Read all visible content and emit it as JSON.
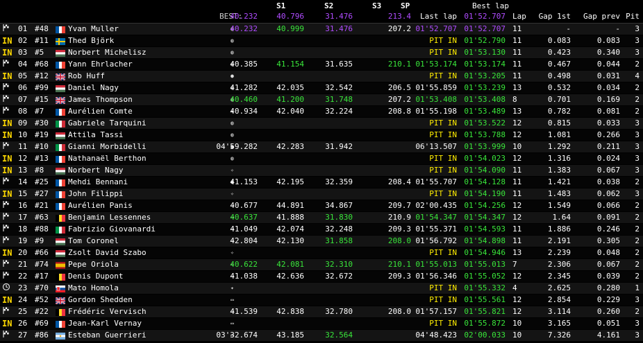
{
  "header": {
    "best_label": "BEST:",
    "s1": "S1",
    "s2": "S2",
    "s3": "S3",
    "sp": "SP",
    "last_lap": "Last lap",
    "best_lap_top": "Best lap",
    "lap": "Lap",
    "gap1": "Gap 1st",
    "gapprev": "Gap prev",
    "pit": "Pit",
    "best_s1": "40.232",
    "best_s2": "40.796",
    "best_s3": "31.476",
    "best_sp": "213.4",
    "best_lap": "01'52.707"
  },
  "colors": {
    "purple": "#b04cff",
    "green": "#39e63a",
    "yellow": "#ffee00"
  },
  "rows": [
    {
      "status": "flag",
      "pos": "01",
      "num": "#48",
      "flag": "FR",
      "name": "Yvan Muller",
      "s1": "40.232",
      "s1c": "purple",
      "s2": "40.999",
      "s2c": "green",
      "s3": "31.476",
      "s3c": "purple",
      "sp": "207.2",
      "spc": "white",
      "last": "01'52.707",
      "lastc": "purple",
      "best": "01'52.707",
      "bestc": "purple",
      "lap": "11",
      "gap1": "-",
      "gapp": "-",
      "pit": "3"
    },
    {
      "status": "in",
      "pos": "02",
      "num": "#11",
      "flag": "SE",
      "name": "Thed Björk",
      "s1": "",
      "s2": "",
      "s3": "",
      "sp": "",
      "last": "PIT IN",
      "lastc": "yellow",
      "best": "01'52.790",
      "bestc": "green",
      "lap": "11",
      "gap1": "0.083",
      "gapp": "0.083",
      "pit": "3"
    },
    {
      "status": "in",
      "pos": "03",
      "num": "#5",
      "flag": "HU",
      "name": "Norbert Michelisz",
      "s1": "",
      "s2": "",
      "s3": "",
      "sp": "",
      "last": "PIT IN",
      "lastc": "yellow",
      "best": "01'53.130",
      "bestc": "green",
      "lap": "11",
      "gap1": "0.423",
      "gapp": "0.340",
      "pit": "3"
    },
    {
      "status": "flag",
      "pos": "04",
      "num": "#68",
      "flag": "FR",
      "name": "Yann Ehrlacher",
      "s1": "40.385",
      "s1c": "white",
      "s2": "41.154",
      "s2c": "green",
      "s3": "31.635",
      "s3c": "white",
      "sp": "210.1",
      "spc": "green",
      "last": "01'53.174",
      "lastc": "green",
      "best": "01'53.174",
      "bestc": "green",
      "lap": "11",
      "gap1": "0.467",
      "gapp": "0.044",
      "pit": "2"
    },
    {
      "status": "in",
      "pos": "05",
      "num": "#12",
      "flag": "GB",
      "name": "Rob Huff",
      "s1": "",
      "s2": "",
      "s3": "",
      "sp": "",
      "last": "PIT IN",
      "lastc": "yellow",
      "best": "01'53.205",
      "bestc": "green",
      "lap": "11",
      "gap1": "0.498",
      "gapp": "0.031",
      "pit": "4"
    },
    {
      "status": "flag",
      "pos": "06",
      "num": "#99",
      "flag": "HU",
      "name": "Daniel Nagy",
      "s1": "41.282",
      "s1c": "white",
      "s2": "42.035",
      "s2c": "white",
      "s3": "32.542",
      "s3c": "white",
      "sp": "206.5",
      "spc": "white",
      "last": "01'55.859",
      "lastc": "white",
      "best": "01'53.239",
      "bestc": "green",
      "lap": "13",
      "gap1": "0.532",
      "gapp": "0.034",
      "pit": "2"
    },
    {
      "status": "flag",
      "pos": "07",
      "num": "#15",
      "flag": "GB",
      "name": "James Thompson",
      "s1": "40.460",
      "s1c": "green",
      "s2": "41.200",
      "s2c": "green",
      "s3": "31.748",
      "s3c": "green",
      "sp": "207.2",
      "spc": "white",
      "last": "01'53.408",
      "lastc": "green",
      "best": "01'53.408",
      "bestc": "green",
      "lap": "8",
      "gap1": "0.701",
      "gapp": "0.169",
      "pit": "2"
    },
    {
      "status": "flag",
      "pos": "08",
      "num": "#7",
      "flag": "FR",
      "name": "Aurélien Comte",
      "s1": "40.934",
      "s1c": "white",
      "s2": "42.040",
      "s2c": "white",
      "s3": "32.224",
      "s3c": "white",
      "sp": "208.8",
      "spc": "white",
      "last": "01'55.198",
      "lastc": "white",
      "best": "01'53.489",
      "bestc": "green",
      "lap": "13",
      "gap1": "0.782",
      "gapp": "0.081",
      "pit": "2"
    },
    {
      "status": "in",
      "pos": "09",
      "num": "#30",
      "flag": "IT",
      "name": "Gabriele Tarquini",
      "s1": "",
      "s2": "",
      "s3": "",
      "sp": "",
      "last": "PIT IN",
      "lastc": "yellow",
      "best": "01'53.522",
      "bestc": "green",
      "lap": "12",
      "gap1": "0.815",
      "gapp": "0.033",
      "pit": "3"
    },
    {
      "status": "in",
      "pos": "10",
      "num": "#19",
      "flag": "HU",
      "name": "Attila Tassi",
      "s1": "",
      "s2": "",
      "s3": "",
      "sp": "",
      "last": "PIT IN",
      "lastc": "yellow",
      "best": "01'53.788",
      "bestc": "green",
      "lap": "12",
      "gap1": "1.081",
      "gapp": "0.266",
      "pit": "3"
    },
    {
      "status": "flag",
      "pos": "11",
      "num": "#10",
      "flag": "IT",
      "name": "Gianni Morbidelli",
      "s1": "04'59.282",
      "s1c": "white",
      "s2": "42.283",
      "s2c": "white",
      "s3": "31.942",
      "s3c": "white",
      "sp": "",
      "spc": "white",
      "last": "06'13.507",
      "lastc": "white",
      "best": "01'53.999",
      "bestc": "green",
      "lap": "10",
      "gap1": "1.292",
      "gapp": "0.211",
      "pit": "3"
    },
    {
      "status": "in",
      "pos": "12",
      "num": "#13",
      "flag": "FR",
      "name": "Nathanaël Berthon",
      "s1": "",
      "s2": "",
      "s3": "",
      "sp": "",
      "last": "PIT IN",
      "lastc": "yellow",
      "best": "01'54.023",
      "bestc": "green",
      "lap": "12",
      "gap1": "1.316",
      "gapp": "0.024",
      "pit": "3"
    },
    {
      "status": "in",
      "pos": "13",
      "num": "#8",
      "flag": "HU",
      "name": "Norbert Nagy",
      "s1": "",
      "s2": "",
      "s3": "",
      "sp": "",
      "last": "PIT IN",
      "lastc": "yellow",
      "best": "01'54.090",
      "bestc": "green",
      "lap": "11",
      "gap1": "1.383",
      "gapp": "0.067",
      "pit": "3"
    },
    {
      "status": "flag",
      "pos": "14",
      "num": "#25",
      "flag": "FR",
      "name": "Mehdi Bennani",
      "s1": "41.153",
      "s1c": "white",
      "s2": "42.195",
      "s2c": "white",
      "s3": "32.359",
      "s3c": "white",
      "sp": "208.4",
      "spc": "white",
      "last": "01'55.707",
      "lastc": "white",
      "best": "01'54.128",
      "bestc": "green",
      "lap": "11",
      "gap1": "1.421",
      "gapp": "0.038",
      "pit": "2"
    },
    {
      "status": "in",
      "pos": "15",
      "num": "#27",
      "flag": "FR",
      "name": "John Filippi",
      "s1": "",
      "s2": "",
      "s3": "",
      "sp": "",
      "last": "PIT IN",
      "lastc": "yellow",
      "best": "01'54.190",
      "bestc": "green",
      "lap": "11",
      "gap1": "1.483",
      "gapp": "0.062",
      "pit": "3"
    },
    {
      "status": "flag",
      "pos": "16",
      "num": "#21",
      "flag": "FR",
      "name": "Aurélien Panis",
      "s1": "40.677",
      "s1c": "white",
      "s2": "44.891",
      "s2c": "white",
      "s3": "34.867",
      "s3c": "white",
      "sp": "209.7",
      "spc": "white",
      "last": "02'00.435",
      "lastc": "white",
      "best": "01'54.256",
      "bestc": "green",
      "lap": "12",
      "gap1": "1.549",
      "gapp": "0.066",
      "pit": "2"
    },
    {
      "status": "flag",
      "pos": "17",
      "num": "#63",
      "flag": "BE",
      "name": "Benjamin Lessennes",
      "s1": "40.637",
      "s1c": "green",
      "s2": "41.888",
      "s2c": "white",
      "s3": "31.830",
      "s3c": "green",
      "sp": "210.9",
      "spc": "white",
      "last": "01'54.347",
      "lastc": "green",
      "best": "01'54.347",
      "bestc": "green",
      "lap": "12",
      "gap1": "1.64",
      "gapp": "0.091",
      "pit": "2"
    },
    {
      "status": "flag",
      "pos": "18",
      "num": "#88",
      "flag": "IT",
      "name": "Fabrizio Giovanardi",
      "s1": "41.049",
      "s1c": "white",
      "s2": "42.074",
      "s2c": "white",
      "s3": "32.248",
      "s3c": "white",
      "sp": "209.3",
      "spc": "white",
      "last": "01'55.371",
      "lastc": "white",
      "best": "01'54.593",
      "bestc": "green",
      "lap": "11",
      "gap1": "1.886",
      "gapp": "0.246",
      "pit": "2"
    },
    {
      "status": "flag",
      "pos": "19",
      "num": "#9",
      "flag": "HU",
      "name": "Tom Coronel",
      "s1": "42.804",
      "s1c": "white",
      "s2": "42.130",
      "s2c": "white",
      "s3": "31.858",
      "s3c": "green",
      "sp": "208.0",
      "spc": "green",
      "last": "01'56.792",
      "lastc": "white",
      "best": "01'54.898",
      "bestc": "green",
      "lap": "11",
      "gap1": "2.191",
      "gapp": "0.305",
      "pit": "2"
    },
    {
      "status": "in",
      "pos": "20",
      "num": "#66",
      "flag": "HU",
      "name": "Zsolt David Szabo",
      "s1": "",
      "s2": "",
      "s3": "",
      "sp": "",
      "last": "PIT IN",
      "lastc": "yellow",
      "best": "01'54.946",
      "bestc": "green",
      "lap": "13",
      "gap1": "2.239",
      "gapp": "0.048",
      "pit": "2"
    },
    {
      "status": "flag",
      "pos": "21",
      "num": "#74",
      "flag": "ES",
      "name": "Pepe Oriola",
      "s1": "40.622",
      "s1c": "green",
      "s2": "42.081",
      "s2c": "green",
      "s3": "32.310",
      "s3c": "green",
      "sp": "210.1",
      "spc": "green",
      "last": "01'55.013",
      "lastc": "green",
      "best": "01'55.013",
      "bestc": "green",
      "lap": "7",
      "gap1": "2.306",
      "gapp": "0.067",
      "pit": "2"
    },
    {
      "status": "flag",
      "pos": "22",
      "num": "#17",
      "flag": "BE",
      "name": "Denis Dupont",
      "s1": "41.038",
      "s1c": "white",
      "s2": "42.636",
      "s2c": "white",
      "s3": "32.672",
      "s3c": "white",
      "sp": "209.3",
      "spc": "white",
      "last": "01'56.346",
      "lastc": "white",
      "best": "01'55.052",
      "bestc": "green",
      "lap": "12",
      "gap1": "2.345",
      "gapp": "0.039",
      "pit": "2"
    },
    {
      "status": "clock",
      "pos": "23",
      "num": "#70",
      "flag": "SK",
      "name": "Mato Homola",
      "s1": "",
      "s2": "",
      "s3": "",
      "sp": "",
      "last": "PIT IN",
      "lastc": "yellow",
      "best": "01'55.332",
      "bestc": "green",
      "lap": "4",
      "gap1": "2.625",
      "gapp": "0.280",
      "pit": "1"
    },
    {
      "status": "in",
      "pos": "24",
      "num": "#52",
      "flag": "GB",
      "name": "Gordon Shedden",
      "s1": "",
      "s2": "",
      "s3": "",
      "sp": "",
      "last": "PIT IN",
      "lastc": "yellow",
      "best": "01'55.561",
      "bestc": "green",
      "lap": "12",
      "gap1": "2.854",
      "gapp": "0.229",
      "pit": "3"
    },
    {
      "status": "flag",
      "pos": "25",
      "num": "#22",
      "flag": "BE",
      "name": "Frédéric Vervisch",
      "s1": "41.539",
      "s1c": "white",
      "s2": "42.838",
      "s2c": "white",
      "s3": "32.780",
      "s3c": "white",
      "sp": "208.0",
      "spc": "white",
      "last": "01'57.157",
      "lastc": "white",
      "best": "01'55.821",
      "bestc": "green",
      "lap": "12",
      "gap1": "3.114",
      "gapp": "0.260",
      "pit": "2"
    },
    {
      "status": "in",
      "pos": "26",
      "num": "#69",
      "flag": "FR",
      "name": "Jean-Karl Vernay",
      "s1": "",
      "s2": "",
      "s3": "",
      "sp": "",
      "last": "PIT IN",
      "lastc": "yellow",
      "best": "01'55.872",
      "bestc": "green",
      "lap": "10",
      "gap1": "3.165",
      "gapp": "0.051",
      "pit": "3"
    },
    {
      "status": "flag",
      "pos": "27",
      "num": "#86",
      "flag": "AR",
      "name": "Esteban Guerrieri",
      "s1": "03'32.674",
      "s1c": "white",
      "s2": "43.185",
      "s2c": "white",
      "s3": "32.564",
      "s3c": "green",
      "sp": "",
      "spc": "white",
      "last": "04'48.423",
      "lastc": "white",
      "best": "02'00.033",
      "bestc": "green",
      "lap": "10",
      "gap1": "7.326",
      "gapp": "4.161",
      "pit": "3"
    }
  ]
}
